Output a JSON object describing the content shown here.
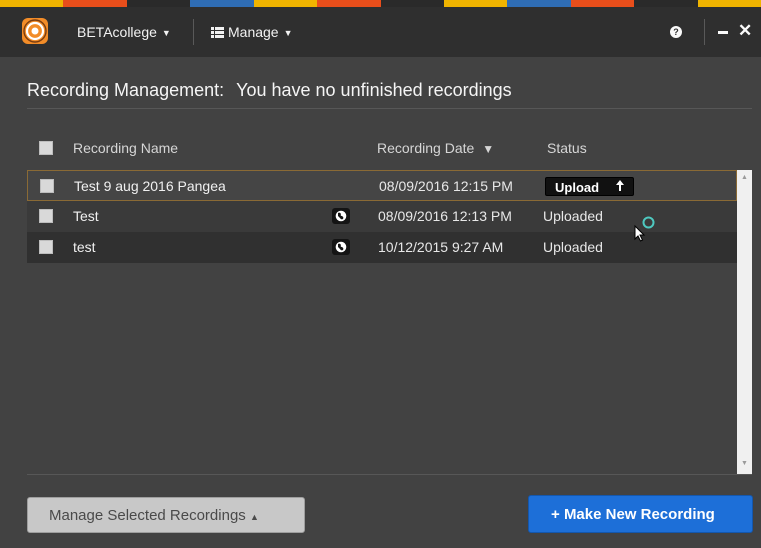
{
  "colors": {
    "accent_strip": [
      "#f0b400",
      "#e94e1b",
      "#2a2a2a",
      "#2f6db5",
      "#f0b400",
      "#e94e1b",
      "#2a2a2a",
      "#f0b400",
      "#2f6db5",
      "#e94e1b",
      "#2a2a2a",
      "#f0b400"
    ],
    "primary_button": "#1d6fd8",
    "logo": "#f28c28"
  },
  "titlebar": {
    "college_menu": "BETAcollege",
    "manage_menu": "Manage",
    "help_glyph": "?",
    "icons": [
      "app-logo",
      "help-icon",
      "minimize-icon",
      "close-icon"
    ]
  },
  "heading": {
    "section": "Recording Management:",
    "message": "You have no unfinished recordings"
  },
  "table": {
    "columns": {
      "name": "Recording Name",
      "date": "Recording Date",
      "status": "Status"
    },
    "rows": [
      {
        "name": "Test 9 aug 2016 Pangea",
        "date": "08/09/2016 12:15 PM",
        "status": "Upload",
        "web": false
      },
      {
        "name": "Test",
        "date": "08/09/2016 12:13 PM",
        "status": "Uploaded",
        "web": true
      },
      {
        "name": "test",
        "date": "10/12/2015 9:27 AM",
        "status": "Uploaded",
        "web": true
      }
    ]
  },
  "footer": {
    "manage_selected": "Manage Selected Recordings",
    "make_new": "Make New Recording"
  }
}
